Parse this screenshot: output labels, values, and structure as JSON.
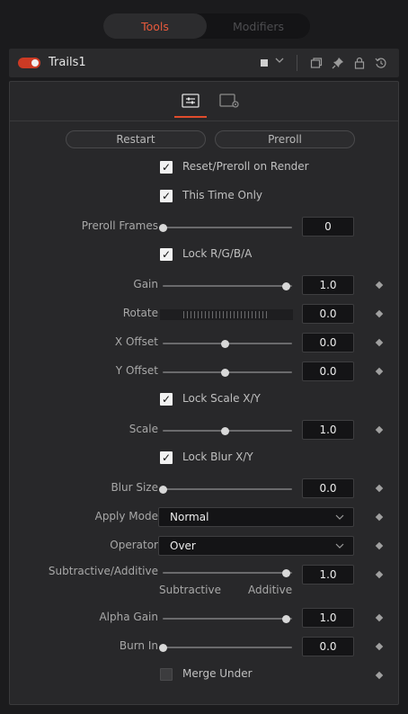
{
  "tabs": [
    {
      "label": "Tools"
    },
    {
      "label": "Modifiers"
    }
  ],
  "node": {
    "name": "Trails1"
  },
  "buttons": {
    "restart": "Restart",
    "preroll": "Preroll"
  },
  "checkboxes": {
    "reset_preroll": {
      "label": "Reset/Preroll on Render",
      "checked": true
    },
    "this_time_only": {
      "label": "This Time Only",
      "checked": true
    },
    "lock_rgba": {
      "label": "Lock R/G/B/A",
      "checked": true
    },
    "lock_scale": {
      "label": "Lock Scale X/Y",
      "checked": true
    },
    "lock_blur": {
      "label": "Lock Blur X/Y",
      "checked": true
    },
    "merge_under": {
      "label": "Merge Under",
      "checked": false
    }
  },
  "controls": {
    "preroll_frames": {
      "label": "Preroll Frames",
      "value": "0",
      "slider": 0.0
    },
    "gain": {
      "label": "Gain",
      "value": "1.0",
      "slider": 1.0
    },
    "rotate": {
      "label": "Rotate",
      "value": "0.0"
    },
    "x_offset": {
      "label": "X Offset",
      "value": "0.0",
      "slider": 0.5
    },
    "y_offset": {
      "label": "Y Offset",
      "value": "0.0",
      "slider": 0.5
    },
    "scale": {
      "label": "Scale",
      "value": "1.0",
      "slider": 0.5
    },
    "blur_size": {
      "label": "Blur Size",
      "value": "0.0",
      "slider": 0.0
    },
    "apply_mode": {
      "label": "Apply Mode",
      "value": "Normal"
    },
    "operator": {
      "label": "Operator",
      "value": "Over"
    },
    "subtractive_additive": {
      "label": "Subtractive/Additive",
      "value": "1.0",
      "slider": 1.0,
      "left_label": "Subtractive",
      "right_label": "Additive"
    },
    "alpha_gain": {
      "label": "Alpha Gain",
      "value": "1.0",
      "slider": 1.0
    },
    "burn_in": {
      "label": "Burn In",
      "value": "0.0",
      "slider": 0.0
    }
  },
  "colors": {
    "accent": "#e85a3c",
    "toggle": "#cc3a24"
  }
}
